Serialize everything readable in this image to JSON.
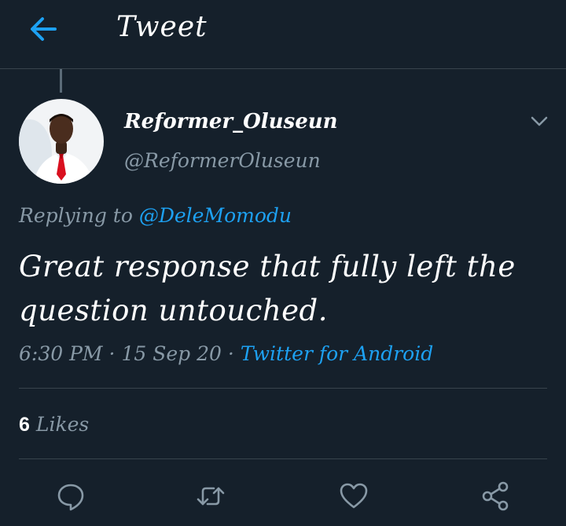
{
  "header": {
    "title": "Tweet",
    "back_icon": "arrow-left-icon"
  },
  "colors": {
    "background": "#15202b",
    "accent": "#1da1f2",
    "muted": "#8899a6",
    "divider": "#38444d"
  },
  "tweet": {
    "author": {
      "display_name": "Reformer_Oluseun",
      "handle": "@ReformerOluseun"
    },
    "replying_prefix": "Replying to",
    "replying_to": "@DeleMomodu",
    "text": "Great response that fully left the question untouched.",
    "time": "6:30 PM",
    "date": "15 Sep 20",
    "source": "Twitter for Android",
    "likes_count": "6",
    "likes_label": "Likes"
  },
  "actions": [
    {
      "name": "reply",
      "icon": "comment-icon"
    },
    {
      "name": "retweet",
      "icon": "retweet-icon"
    },
    {
      "name": "like",
      "icon": "heart-icon"
    },
    {
      "name": "share",
      "icon": "share-icon"
    }
  ]
}
